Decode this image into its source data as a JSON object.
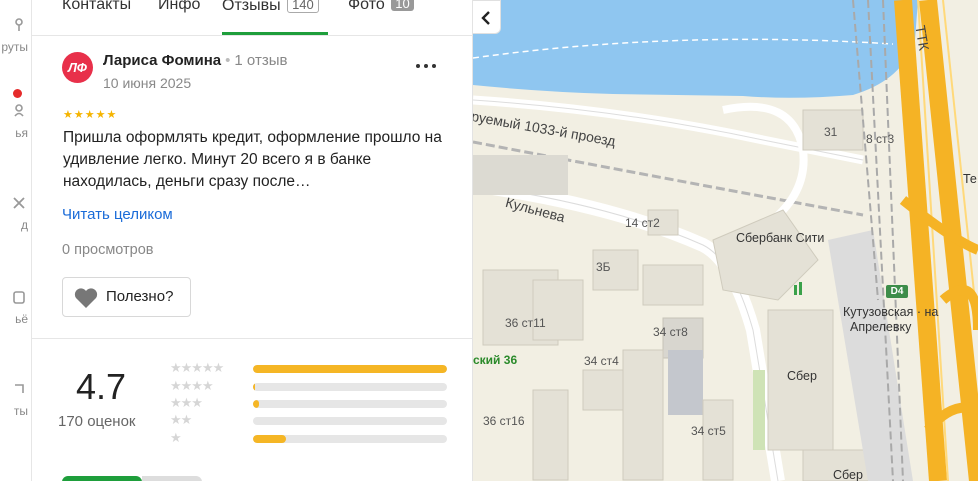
{
  "rail": {
    "items": [
      {
        "label": "руты"
      },
      {
        "label": "ья"
      },
      {
        "label": "д"
      },
      {
        "label": "ьё"
      },
      {
        "label": "ты"
      }
    ]
  },
  "tabs": [
    {
      "label": "Контакты"
    },
    {
      "label": "Инфо"
    },
    {
      "label": "Отзывы",
      "count": "140"
    },
    {
      "label": "Фото",
      "count": "10"
    }
  ],
  "review": {
    "avatar_initials": "ЛФ",
    "author": "Лариса Фомина",
    "reviews_count": "1 отзыв",
    "date": "10 июня 2025",
    "stars": 5,
    "text": "Пришла оформлять кредит, оформление прошло на удивление легко. Минут 20 всего я в банке находилась, деньги сразу после…",
    "read_more": "Читать целиком",
    "views": "0 просмотров",
    "useful_label": "Полезно?"
  },
  "summary": {
    "rating": "4.7",
    "ratings_count": "170 оценок",
    "distribution": [
      {
        "stars": 5,
        "fraction": 1.0
      },
      {
        "stars": 4,
        "fraction": 0.01
      },
      {
        "stars": 3,
        "fraction": 0.03
      },
      {
        "stars": 2,
        "fraction": 0.0
      },
      {
        "stars": 1,
        "fraction": 0.17
      }
    ]
  },
  "map": {
    "labels": {
      "proezd": "руемый 1033-й проезд",
      "kulneva": "Кульнева",
      "ttk": "ТТК",
      "b31": "31",
      "b8st3": "8 ст3",
      "b14st2": "14 ст2",
      "sber_city": "Сбербанк Сити",
      "b3b": "3Б",
      "b36st11": "36 ст11",
      "b34st8": "34 ст8",
      "b34st4": "34 ст4",
      "sky36": "ский 36",
      "b36st16": "36 ст16",
      "b34st5": "34 ст5",
      "sber1": "Сбер",
      "sber2": "Сбер",
      "metro_line": "D4",
      "kutuz": "Кутузовская · на",
      "aprelevka": "Апрелевку",
      "te": "Те"
    }
  }
}
